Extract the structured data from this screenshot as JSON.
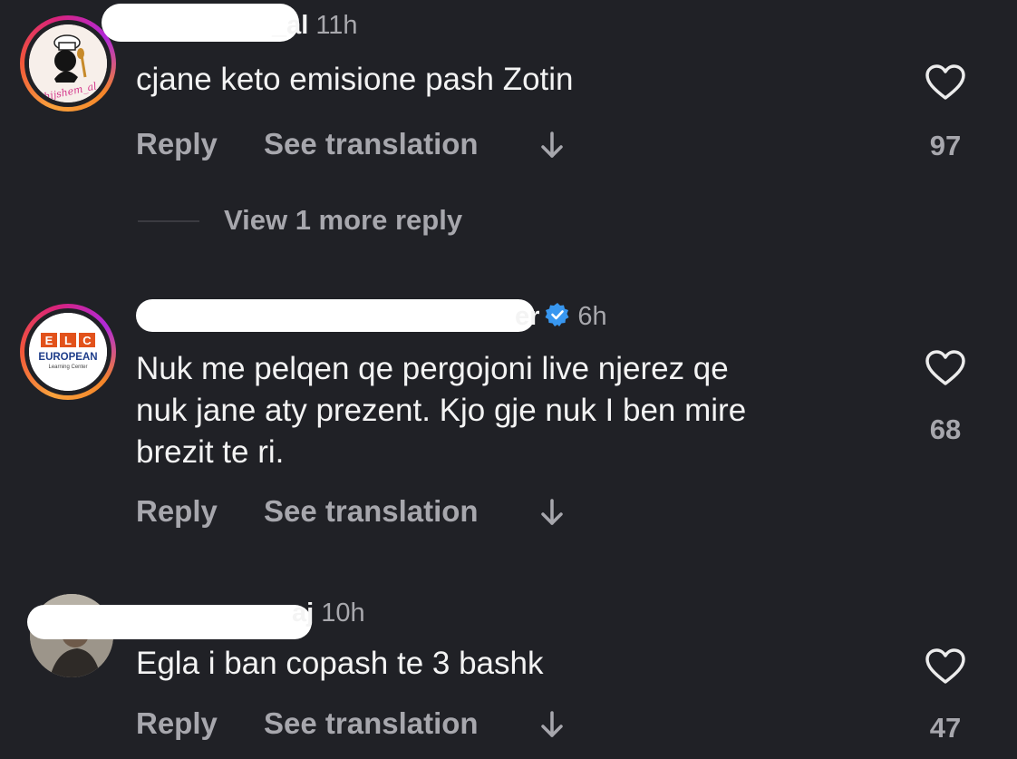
{
  "comments": [
    {
      "username_visible": "_al",
      "time": "11h",
      "text": "cjane keto emisione pash Zotin",
      "reply_label": "Reply",
      "translate_label": "See translation",
      "likes": "97",
      "avatar_text": "shijshem_al"
    },
    {
      "username_visible": "er",
      "time": "6h",
      "text_lines": [
        "Nuk me pelqen qe pergojoni live njerez qe",
        "nuk jane aty prezent. Kjo gje nuk I ben mire",
        "brezit te ri."
      ],
      "reply_label": "Reply",
      "translate_label": "See translation",
      "likes": "68",
      "avatar_logo_top": "ELC",
      "avatar_logo_main": "EUROPEAN",
      "avatar_logo_sub": "Learning Center"
    },
    {
      "username_visible": "aj",
      "time": "10h",
      "text": "Egla i ban copash te 3 bashk",
      "reply_label": "Reply",
      "translate_label": "See translation",
      "likes": "47"
    }
  ],
  "view_more_label": "View 1 more reply",
  "colors": {
    "background": "#202126",
    "text": "#f3f3f3",
    "muted": "#a7a7ad",
    "verified": "#3897f0"
  }
}
